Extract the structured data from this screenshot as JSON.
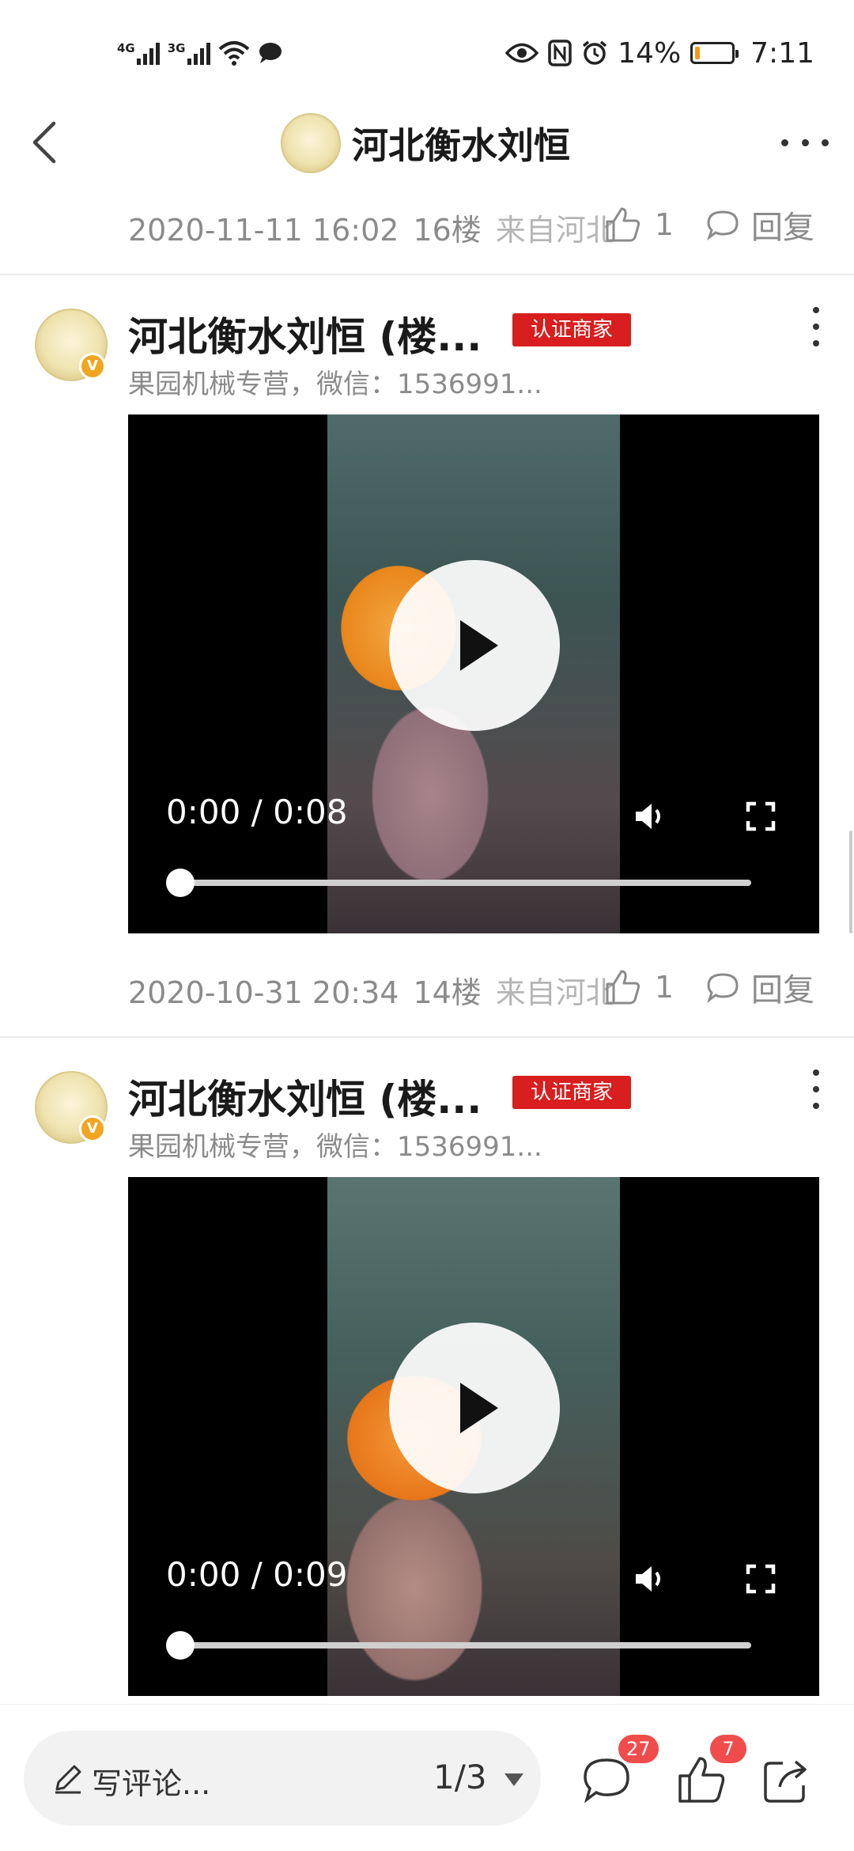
{
  "status_bar": {
    "network1": "4G",
    "network2": "3G",
    "battery_percent_text": "14%",
    "battery_level": 0.14,
    "time": "7:11"
  },
  "nav": {
    "title": "河北衡水刘恒"
  },
  "colors": {
    "badge_red": "#d81e1e",
    "count_badge": "#f04c4c",
    "battery_orange": "#f29a1a"
  },
  "top_meta": {
    "datetime": "2020-11-11 16:02",
    "floor": "16楼",
    "from": "来自河北",
    "likes": "1",
    "reply": "回复"
  },
  "posts": [
    {
      "author": "河北衡水刘恒 (楼...",
      "badge": "认证商家",
      "subtitle": "果园机械专营，微信：1536991...",
      "video_time": "0:00 / 0:08",
      "progress": 0,
      "meta": {
        "datetime": "2020-10-31 20:34",
        "floor": "14楼",
        "from": "来自河北",
        "likes": "1",
        "reply": "回复"
      }
    },
    {
      "author": "河北衡水刘恒 (楼...",
      "badge": "认证商家",
      "subtitle": "果园机械专营，微信：1536991...",
      "video_time": "0:00 / 0:09",
      "progress": 0
    }
  ],
  "bottom_bar": {
    "comment_placeholder": "写评论...",
    "page_indicator": "1/3",
    "comments_count": "27",
    "likes_count": "7"
  }
}
